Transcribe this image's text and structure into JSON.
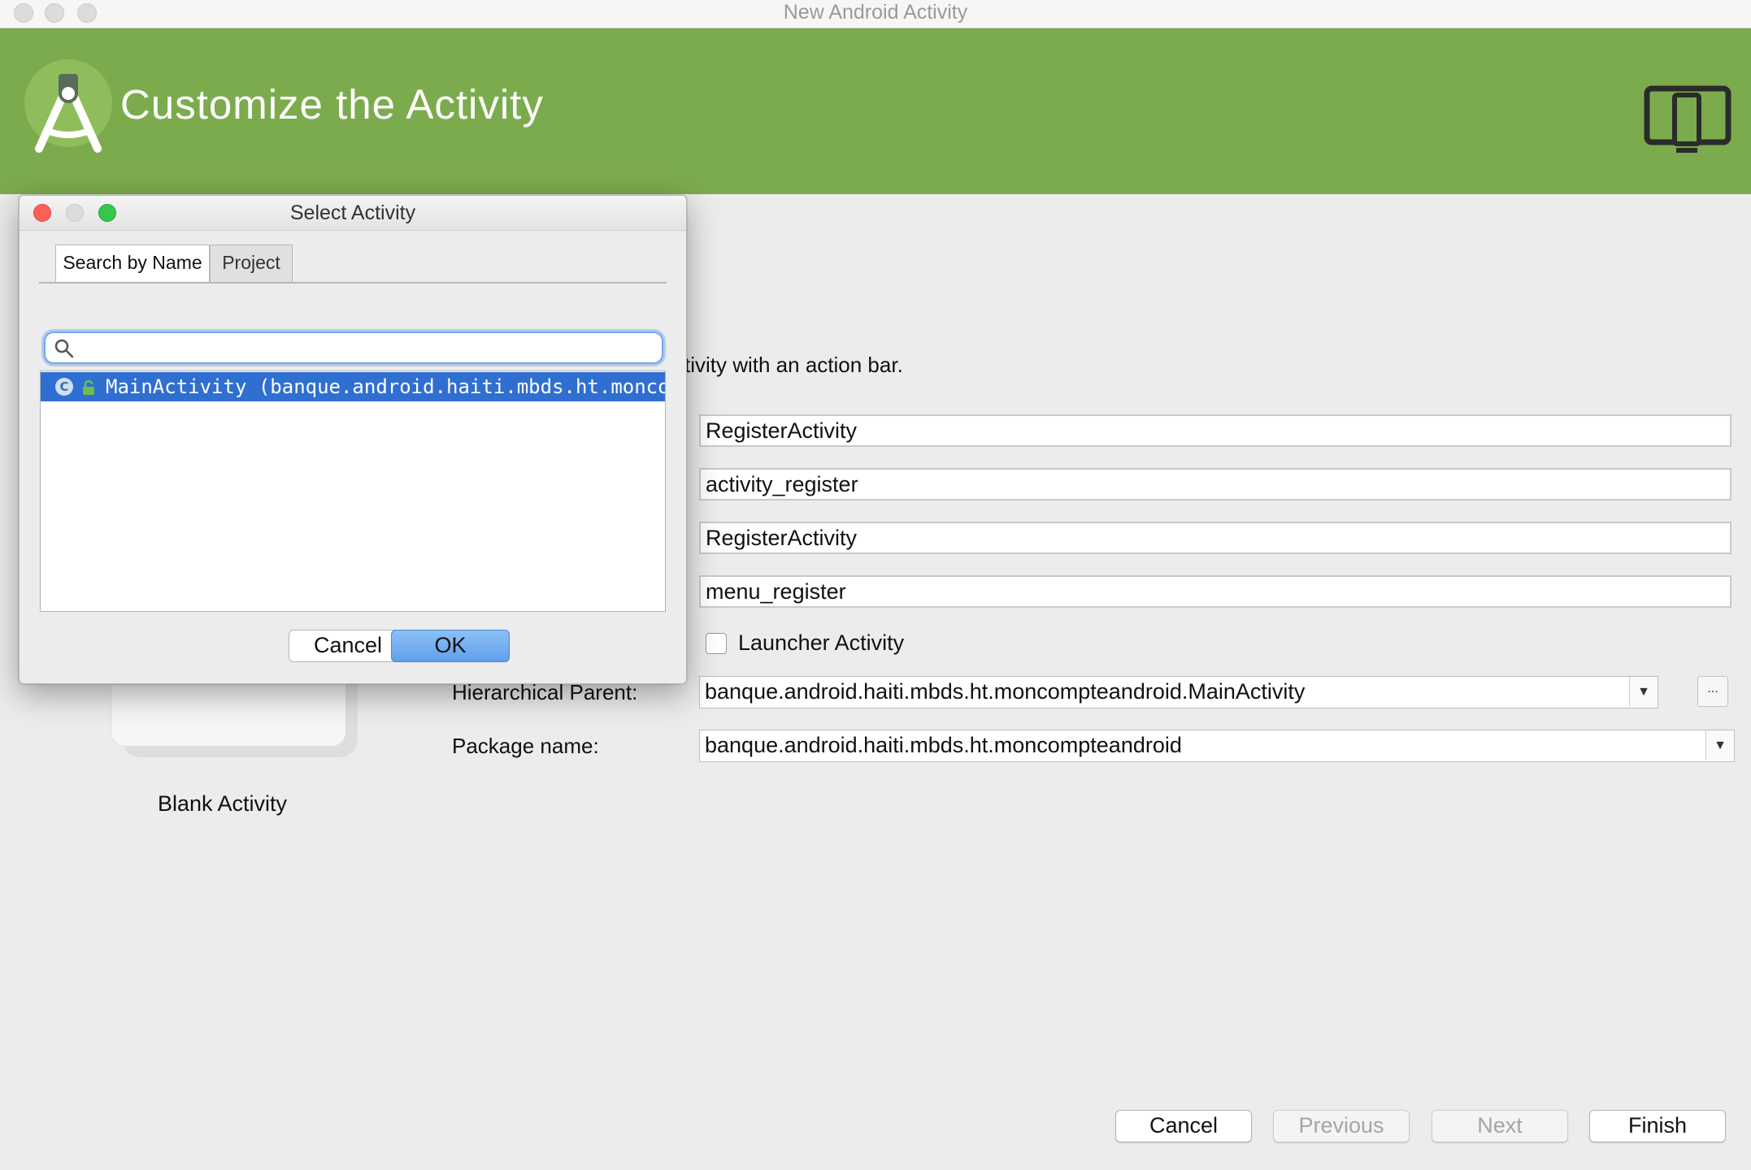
{
  "window": {
    "title": "New Android Activity"
  },
  "header": {
    "title": "Customize the Activity",
    "color": "#7cab4d",
    "logo_icon": "android-studio-logo",
    "device_icon": "device-form-factor-icon"
  },
  "form": {
    "description_partial": "tivity with an action bar.",
    "activity_name": "RegisterActivity",
    "layout_name": "activity_register",
    "title": "RegisterActivity",
    "menu_resource_name": "menu_register",
    "launcher_activity_label": "Launcher Activity",
    "launcher_activity_checked": false,
    "hierarchical_parent_label": "Hierarchical Parent:",
    "hierarchical_parent_value": "banque.android.haiti.mbds.ht.moncompteandroid.MainActivity",
    "package_name_label": "Package name:",
    "package_name_value": "banque.android.haiti.mbds.ht.moncompteandroid",
    "more_button_label": "..."
  },
  "template": {
    "label": "Blank Activity"
  },
  "footer": {
    "cancel": "Cancel",
    "previous": "Previous",
    "next": "Next",
    "finish": "Finish"
  },
  "dialog": {
    "title": "Select Activity",
    "tabs": [
      "Search by Name",
      "Project"
    ],
    "active_tab": "Search by Name",
    "search_value": "",
    "results": [
      {
        "icon": "class-icon",
        "text": "MainActivity (banque.android.haiti.mbds.ht.moncompteandroid)",
        "selected": true
      }
    ],
    "cancel": "Cancel",
    "ok": "OK",
    "selection_color": "#2f6fd1"
  }
}
